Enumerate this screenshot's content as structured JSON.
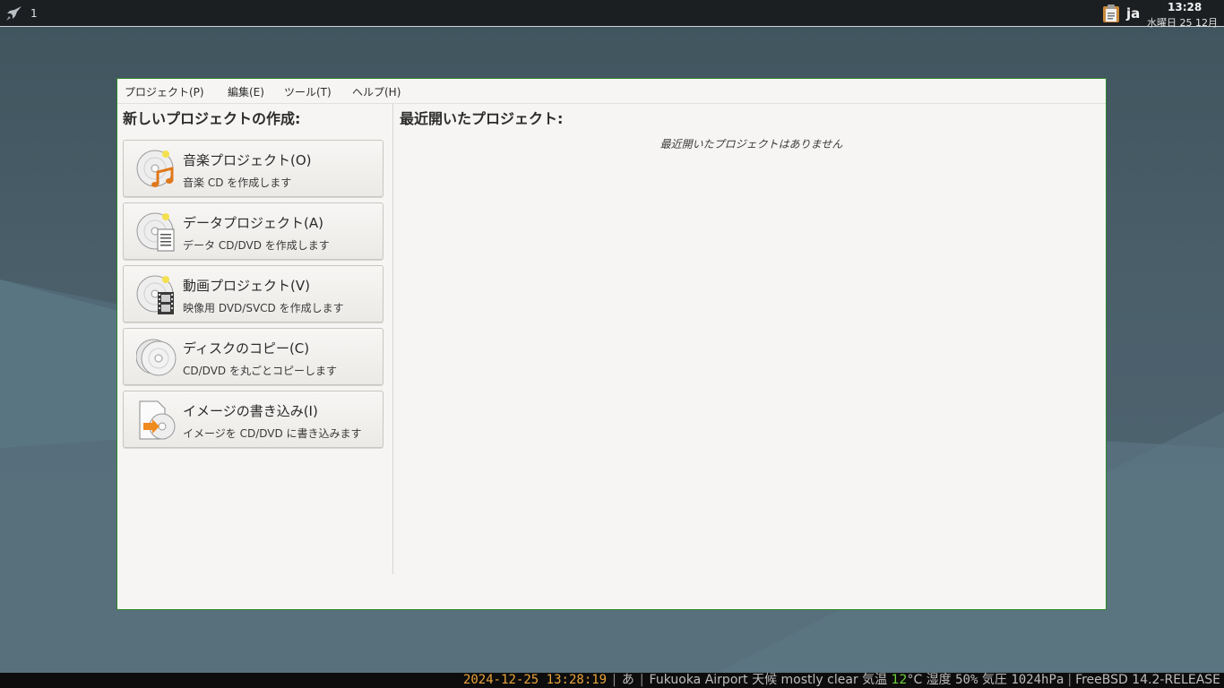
{
  "top_panel": {
    "workspace": "1",
    "lang": "ja",
    "clock_time": "13:28",
    "clock_date": "水曜日 25 12月"
  },
  "menu": {
    "project": "プロジェクト(P)",
    "edit": "編集(E)",
    "tools": "ツール(T)",
    "help": "ヘルプ(H)"
  },
  "new_project": {
    "heading": "新しいプロジェクトの作成:",
    "items": [
      {
        "title": "音楽プロジェクト(O)",
        "desc": "音楽 CD を作成します"
      },
      {
        "title": "データプロジェクト(A)",
        "desc": "データ CD/DVD を作成します"
      },
      {
        "title": "動画プロジェクト(V)",
        "desc": "映像用 DVD/SVCD を作成します"
      },
      {
        "title": "ディスクのコピー(C)",
        "desc": "CD/DVD を丸ごとコピーします"
      },
      {
        "title": "イメージの書き込み(I)",
        "desc": "イメージを CD/DVD に書き込みます"
      }
    ]
  },
  "recent": {
    "heading": "最近開いたプロジェクト:",
    "empty": "最近開いたプロジェクトはありません"
  },
  "status_bar": {
    "datetime": "2024-12-25 13:28:19",
    "ime": "あ",
    "location": "Fukuoka Airport",
    "weather_label": "天候",
    "weather": "mostly clear",
    "temp_label": "気温",
    "temp": "12",
    "temp_unit": "°C",
    "humidity_label": "湿度",
    "humidity": "50%",
    "pressure_label": "気圧",
    "pressure": "1024hPa",
    "os": "FreeBSD 14.2-RELEASE"
  }
}
